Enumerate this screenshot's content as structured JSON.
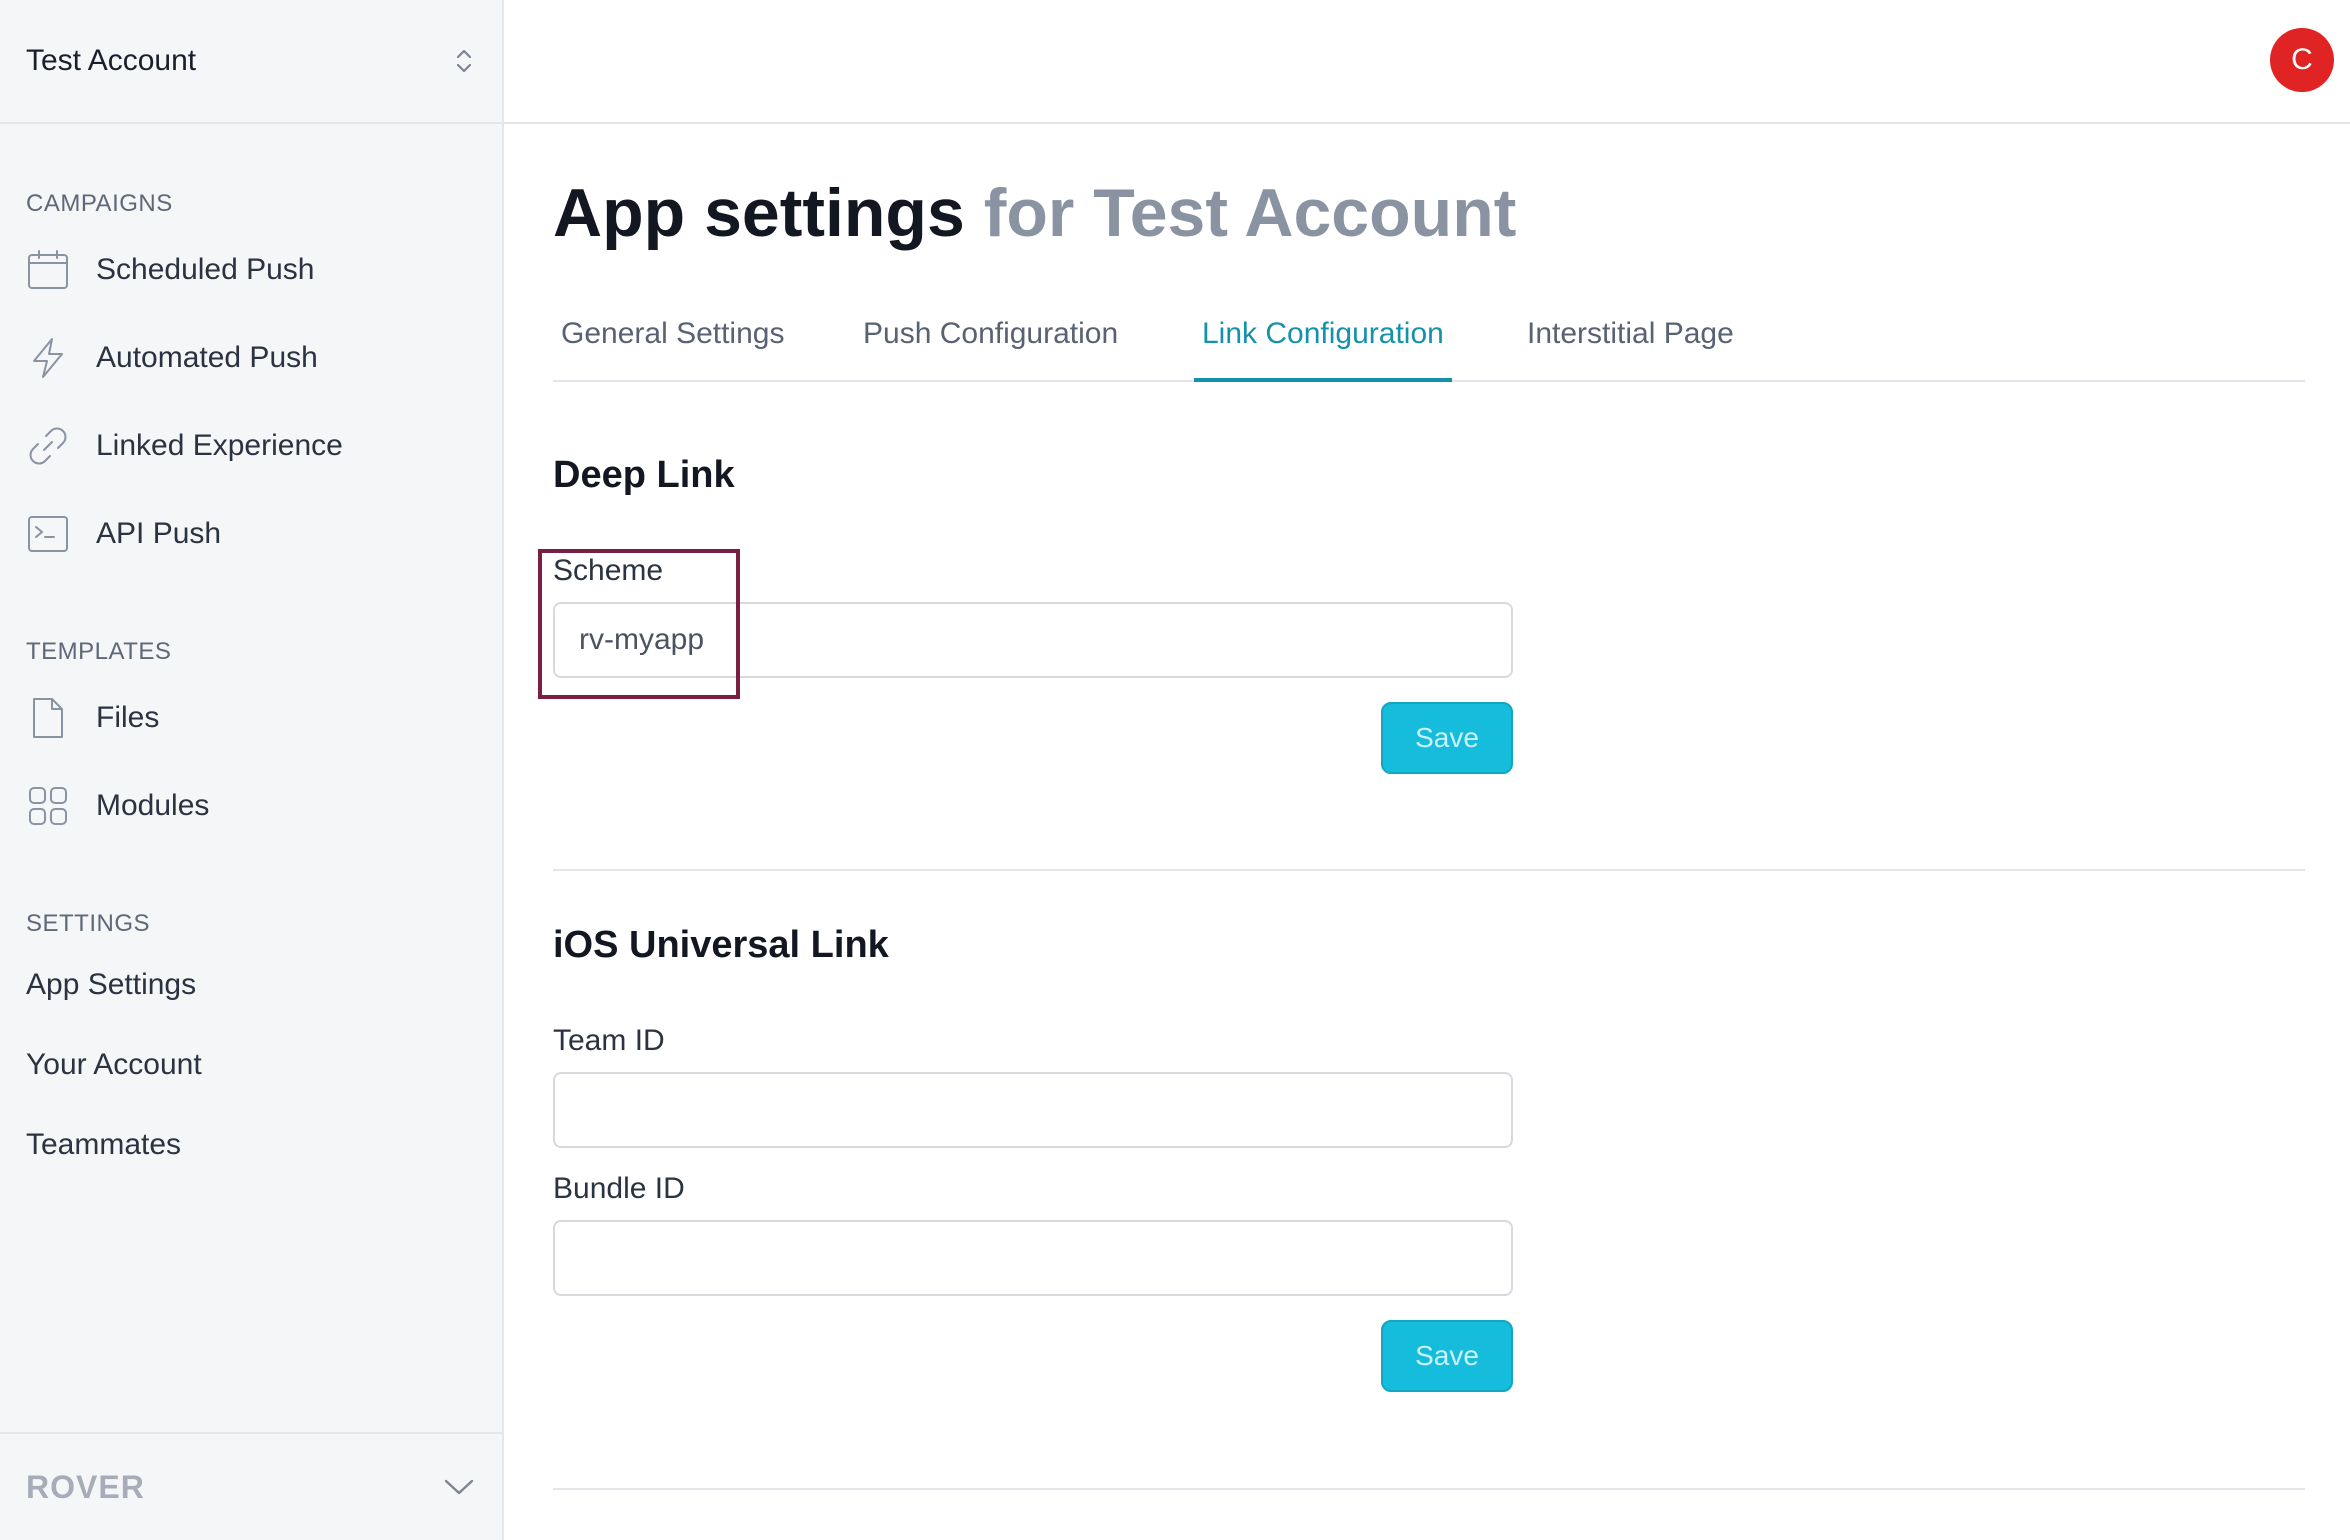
{
  "sidebar": {
    "account_name": "Test Account",
    "sections": {
      "campaigns": "CAMPAIGNS",
      "templates": "TEMPLATES",
      "settings": "SETTINGS"
    },
    "campaign_items": [
      {
        "label": "Scheduled Push",
        "icon": "calendar-icon"
      },
      {
        "label": "Automated Push",
        "icon": "lightning-icon"
      },
      {
        "label": "Linked Experience",
        "icon": "link-icon"
      },
      {
        "label": "API Push",
        "icon": "terminal-icon"
      }
    ],
    "template_items": [
      {
        "label": "Files",
        "icon": "file-icon"
      },
      {
        "label": "Modules",
        "icon": "grid-icon"
      }
    ],
    "settings_items": [
      {
        "label": "App Settings"
      },
      {
        "label": "Your Account"
      },
      {
        "label": "Teammates"
      }
    ],
    "footer_brand": "ROVER"
  },
  "topbar": {
    "avatar_initial": "C",
    "avatar_color": "#e02424"
  },
  "main": {
    "title_strong": "App settings",
    "title_muted": "for Test Account",
    "tabs": [
      {
        "label": "General Settings",
        "active": false
      },
      {
        "label": "Push Configuration",
        "active": false
      },
      {
        "label": "Link Configuration",
        "active": true
      },
      {
        "label": "Interstitial Page",
        "active": false
      }
    ],
    "deep_link": {
      "title": "Deep Link",
      "scheme_label": "Scheme",
      "scheme_value": "rv-myapp",
      "save_label": "Save"
    },
    "ios_universal_link": {
      "title": "iOS Universal Link",
      "team_id_label": "Team ID",
      "team_id_value": "",
      "bundle_id_label": "Bundle ID",
      "bundle_id_value": "",
      "save_label": "Save"
    }
  },
  "colors": {
    "accent": "#1592ab",
    "button": "#16bcdb",
    "highlight": "#7a1f42"
  }
}
